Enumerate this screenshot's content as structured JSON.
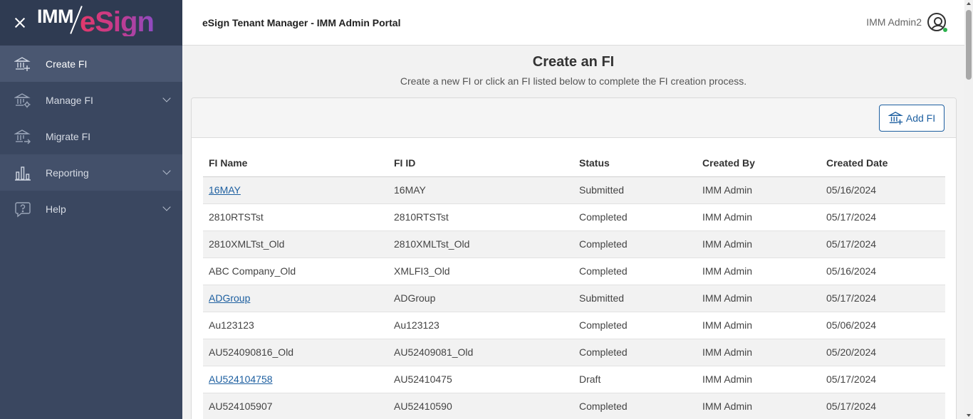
{
  "brand": {
    "imm": "IMM",
    "esign": "eSign"
  },
  "sidebar": {
    "items": [
      {
        "label": "Create FI",
        "icon": "bank-add-icon",
        "active": true
      },
      {
        "label": "Manage FI",
        "icon": "bank-gear-icon",
        "has_chevron": true
      },
      {
        "label": "Migrate FI",
        "icon": "bank-arrow-icon"
      },
      {
        "label": "Reporting",
        "icon": "bar-chart-icon",
        "has_chevron": true
      },
      {
        "label": "Help",
        "icon": "help-bubble-icon",
        "has_chevron": true
      }
    ]
  },
  "header": {
    "title": "eSign Tenant Manager - IMM Admin Portal",
    "user_name": "IMM Admin2"
  },
  "main": {
    "title": "Create an FI",
    "subtitle": "Create a new FI or click an FI listed below to complete the FI creation process.",
    "add_button": "Add FI"
  },
  "table": {
    "columns": [
      "FI Name",
      "FI ID",
      "Status",
      "Created By",
      "Created Date"
    ],
    "rows": [
      {
        "name": "16MAY",
        "id": "16MAY",
        "status": "Submitted",
        "by": "IMM Admin",
        "date": "05/16/2024",
        "link": true
      },
      {
        "name": "2810RTSTst",
        "id": "2810RTSTst",
        "status": "Completed",
        "by": "IMM Admin",
        "date": "05/17/2024",
        "link": false
      },
      {
        "name": "2810XMLTst_Old",
        "id": "2810XMLTst_Old",
        "status": "Completed",
        "by": "IMM Admin",
        "date": "05/17/2024",
        "link": false
      },
      {
        "name": "ABC Company_Old",
        "id": "XMLFI3_Old",
        "status": "Completed",
        "by": "IMM Admin",
        "date": "05/16/2024",
        "link": false
      },
      {
        "name": "ADGroup",
        "id": "ADGroup",
        "status": "Submitted",
        "by": "IMM Admin",
        "date": "05/17/2024",
        "link": true
      },
      {
        "name": "Au123123",
        "id": "Au123123",
        "status": "Completed",
        "by": "IMM Admin",
        "date": "05/06/2024",
        "link": false
      },
      {
        "name": "AU524090816_Old",
        "id": "AU52409081_Old",
        "status": "Completed",
        "by": "IMM Admin",
        "date": "05/20/2024",
        "link": false
      },
      {
        "name": "AU524104758",
        "id": "AU52410475",
        "status": "Draft",
        "by": "IMM Admin",
        "date": "05/17/2024",
        "link": true
      },
      {
        "name": "AU524105907",
        "id": "AU52410590",
        "status": "Completed",
        "by": "IMM Admin",
        "date": "05/17/2024",
        "link": false
      }
    ]
  },
  "colors": {
    "sidebar_bg": "#3a4760",
    "accent": "#1d5fa0"
  }
}
